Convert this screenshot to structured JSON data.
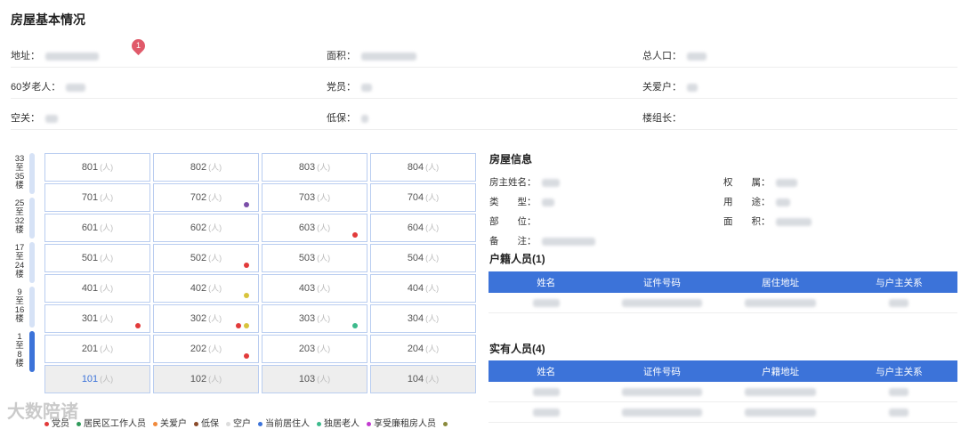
{
  "page": {
    "title": "房屋基本情况"
  },
  "summary": {
    "address_label": "地址：",
    "area_label": "面积：",
    "population_label": "总人口：",
    "elderly_label": "60岁老人：",
    "party_label": "党员：",
    "care_label": "关爱户：",
    "vacant_label": "空关：",
    "lowincome_label": "低保：",
    "leader_label": "楼组长：",
    "badge": "1"
  },
  "buildings": [
    {
      "label": "33\n至\n35\n楼",
      "active": false
    },
    {
      "label": "25\n至\n32\n楼",
      "active": false
    },
    {
      "label": "17\n至\n24\n楼",
      "active": false
    },
    {
      "label": "9\n至\n16\n楼",
      "active": false
    },
    {
      "label": "1\n至\n8\n楼",
      "active": true
    }
  ],
  "units": {
    "people_suffix": "(人)",
    "rows": [
      [
        "801",
        "802",
        "803",
        "804"
      ],
      [
        "701",
        "702",
        "703",
        "704"
      ],
      [
        "601",
        "602",
        "603",
        "604"
      ],
      [
        "501",
        "502",
        "503",
        "504"
      ],
      [
        "401",
        "402",
        "403",
        "404"
      ],
      [
        "301",
        "302",
        "303",
        "304"
      ],
      [
        "201",
        "202",
        "203",
        "204"
      ],
      [
        "101",
        "102",
        "103",
        "104"
      ]
    ],
    "markers": [
      {
        "unit": "702",
        "colors": [
          "#7b4ea8"
        ]
      },
      {
        "unit": "603",
        "colors": [
          "#e23a3a"
        ]
      },
      {
        "unit": "502",
        "colors": [
          "#e23a3a"
        ]
      },
      {
        "unit": "402",
        "colors": [
          "#d8c43c"
        ]
      },
      {
        "unit": "301",
        "colors": [
          "#e23a3a"
        ]
      },
      {
        "unit": "302",
        "colors": [
          "#e23a3a",
          "#d8c43c"
        ]
      },
      {
        "unit": "303",
        "colors": [
          "#3cba8c"
        ]
      },
      {
        "unit": "202",
        "colors": [
          "#e23a3a"
        ]
      }
    ]
  },
  "legend": [
    {
      "label": "党员",
      "color": "#e23a3a"
    },
    {
      "label": "居民区工作人员",
      "color": "#2f9a5a"
    },
    {
      "label": "关爱户",
      "color": "#f08a3c"
    },
    {
      "label": "低保",
      "color": "#8a4a2a"
    },
    {
      "label": "空户",
      "color": "#dddddd"
    },
    {
      "label": "当前居住人",
      "color": "#3c73d9"
    },
    {
      "label": "独居老人",
      "color": "#3cba8c"
    },
    {
      "label": "享受廉租房人员",
      "color": "#c23ad0"
    },
    {
      "label": "",
      "color": "#8a8a3c"
    }
  ],
  "watermark": "大数陪诸",
  "house_info": {
    "title": "房屋信息",
    "owner_label": "房主姓名：",
    "ownership_label": "权　　属：",
    "type_label": "类　　型：",
    "usage_label": "用　　途：",
    "location_label": "部　　位：",
    "area_label": "面　　积：",
    "remark_label": "备　　注："
  },
  "registered": {
    "title": "户籍人员(1)",
    "columns": [
      "姓名",
      "证件号码",
      "居住地址",
      "与户主关系"
    ],
    "row_count": 1
  },
  "actual": {
    "title": "实有人员(4)",
    "columns": [
      "姓名",
      "证件号码",
      "户籍地址",
      "与户主关系"
    ],
    "row_count": 2
  }
}
